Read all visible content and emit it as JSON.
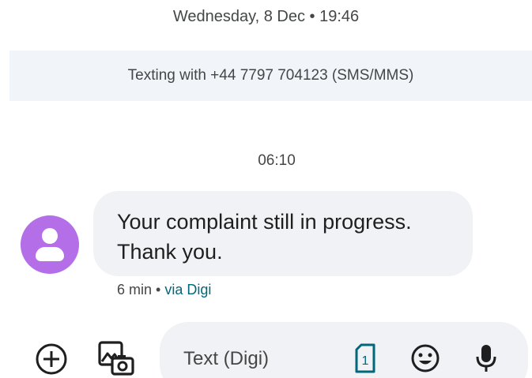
{
  "header": {
    "date": "Wednesday, 8 Dec • 19:46"
  },
  "banner": {
    "text": "Texting with +44 7797 704123 (SMS/MMS)"
  },
  "conversation": {
    "time": "06:10",
    "messages": [
      {
        "text": "Your complaint still in progress. Thank you.",
        "age": "6 min",
        "separator": " • ",
        "via": "via Digi",
        "avatar_color": "#b46ee8"
      }
    ]
  },
  "compose": {
    "placeholder": "Text (Digi)",
    "sim_number": "1",
    "icons": {
      "add": "add-circle-icon",
      "gallery": "gallery-camera-icon",
      "sim": "sim-card-icon",
      "emoji": "emoji-icon",
      "mic": "microphone-icon"
    }
  },
  "colors": {
    "accent_teal": "#00677d",
    "bubble_bg": "#f0f2f5",
    "banner_bg": "#f1f4f9",
    "avatar": "#b46ee8"
  }
}
